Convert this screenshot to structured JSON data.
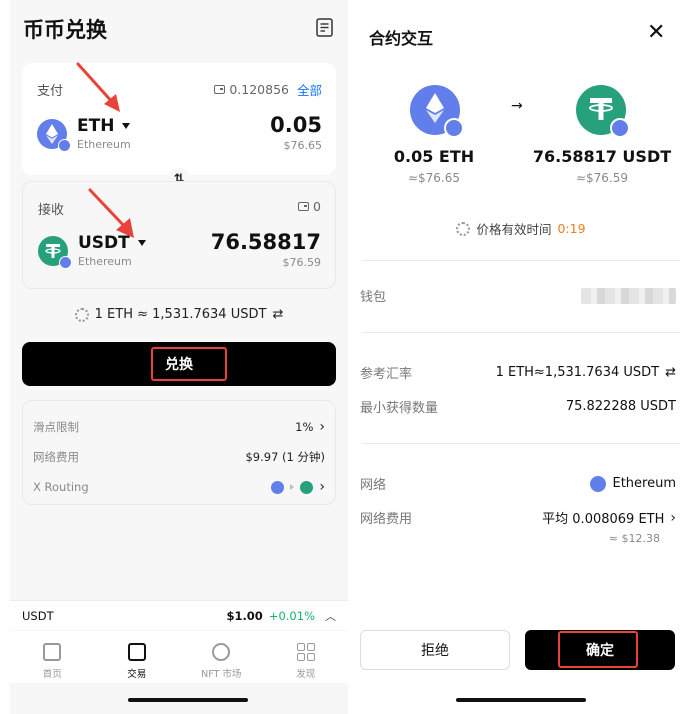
{
  "left": {
    "title": "币币兑换",
    "pay": {
      "label": "支付",
      "balance": "0.120856",
      "all_label": "全部",
      "symbol": "ETH",
      "name": "Ethereum",
      "amount": "0.05",
      "usd": "$76.65"
    },
    "receive": {
      "label": "接收",
      "balance": "0",
      "symbol": "USDT",
      "name": "Ethereum",
      "amount": "76.58817",
      "usd": "$76.59"
    },
    "rate": "1 ETH ≈ 1,531.7634 USDT",
    "swap_label": "兑换",
    "details": [
      {
        "key": "滑点限制",
        "value": "1%"
      },
      {
        "key": "网络费用",
        "value": "$9.97 (1 分钟)"
      },
      {
        "key": "X Routing",
        "value": ""
      }
    ],
    "ticker": {
      "symbol": "USDT",
      "price": "$1.00",
      "change": "+0.01%"
    },
    "tabs": [
      {
        "label": "首页"
      },
      {
        "label": "交易"
      },
      {
        "label": "NFT 市场"
      },
      {
        "label": "发现"
      }
    ]
  },
  "right": {
    "title": "合约交互",
    "from": {
      "amount": "0.05 ETH",
      "usd": "≈$76.65"
    },
    "to": {
      "amount": "76.58817 USDT",
      "usd": "≈$76.59"
    },
    "validity_label": "价格有效时间",
    "validity_time": "0:19",
    "wallet_label": "钱包",
    "ref_rate_label": "参考汇率",
    "ref_rate_value": "1 ETH≈1,531.7634 USDT",
    "min_recv_label": "最小获得数量",
    "min_recv_value": "75.822288 USDT",
    "network_label": "网络",
    "network_value": "Ethereum",
    "fee_label": "网络费用",
    "fee_value": "平均 0.008069 ETH",
    "fee_usd": "≈ $12.38",
    "reject_label": "拒绝",
    "confirm_label": "确定"
  },
  "colors": {
    "eth": "#627eea",
    "usdt": "#26a17b",
    "accent_link": "#1677ff",
    "highlight": "#e8433a",
    "timer": "#f07b1b",
    "positive": "#19b36b"
  }
}
